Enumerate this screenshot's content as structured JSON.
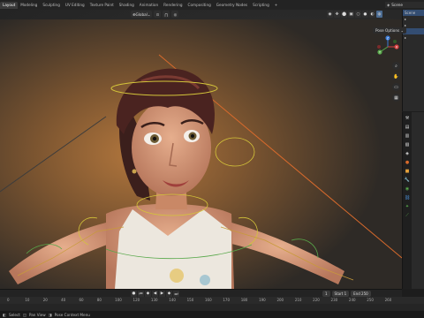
{
  "workspace_tabs": [
    "Layout",
    "Modeling",
    "Sculpting",
    "UV Editing",
    "Texture Paint",
    "Shading",
    "Animation",
    "Rendering",
    "Compositing",
    "Geometry Nodes",
    "Scripting",
    "+"
  ],
  "active_tab_index": 0,
  "scene": {
    "label": "Scene"
  },
  "viewport": {
    "orientation_label": "Global",
    "pose_options_label": "Pose Options",
    "gizmo_axes": [
      "X",
      "Y",
      "Z"
    ]
  },
  "outliner": {
    "rows": [
      "Scene",
      "",
      "",
      "",
      ""
    ]
  },
  "timeline": {
    "current_frame": "1",
    "start_label": "Start",
    "start_value": "1",
    "end_label": "End",
    "end_value": "250",
    "ruler_ticks": [
      "0",
      "10",
      "20",
      "40",
      "60",
      "80",
      "100",
      "120",
      "130",
      "140",
      "150",
      "160",
      "170",
      "180",
      "190",
      "200",
      "210",
      "220",
      "230",
      "240",
      "250",
      "260"
    ]
  },
  "status": {
    "items": [
      "Select",
      "Pan View",
      "Pose Context Menu"
    ]
  },
  "colors": {
    "accent": "#4b6c93",
    "rig_yellow": "#d4c53a",
    "rig_green": "#58a84a",
    "camera_orange": "#d86a2c"
  }
}
